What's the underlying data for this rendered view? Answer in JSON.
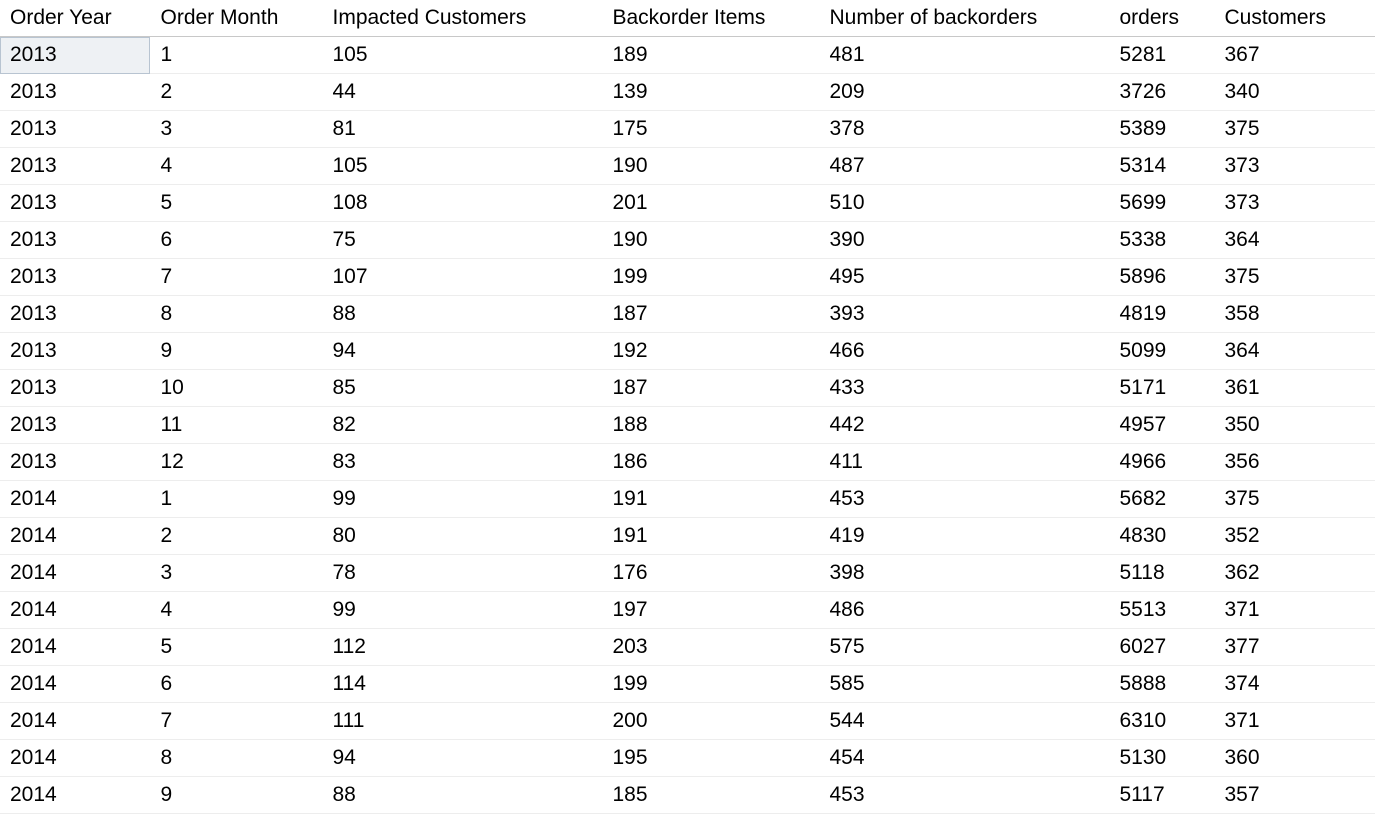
{
  "table": {
    "headers": [
      "Order Year",
      "Order Month",
      "Impacted Customers",
      "Backorder Items",
      "Number of backorders",
      "orders",
      "Customers"
    ],
    "rows": [
      {
        "year": "2013",
        "month": "1",
        "impacted": "105",
        "backitems": "189",
        "backnum": "481",
        "orders": "5281",
        "customers": "367"
      },
      {
        "year": "2013",
        "month": "2",
        "impacted": "44",
        "backitems": "139",
        "backnum": "209",
        "orders": "3726",
        "customers": "340"
      },
      {
        "year": "2013",
        "month": "3",
        "impacted": "81",
        "backitems": "175",
        "backnum": "378",
        "orders": "5389",
        "customers": "375"
      },
      {
        "year": "2013",
        "month": "4",
        "impacted": "105",
        "backitems": "190",
        "backnum": "487",
        "orders": "5314",
        "customers": "373"
      },
      {
        "year": "2013",
        "month": "5",
        "impacted": "108",
        "backitems": "201",
        "backnum": "510",
        "orders": "5699",
        "customers": "373"
      },
      {
        "year": "2013",
        "month": "6",
        "impacted": "75",
        "backitems": "190",
        "backnum": "390",
        "orders": "5338",
        "customers": "364"
      },
      {
        "year": "2013",
        "month": "7",
        "impacted": "107",
        "backitems": "199",
        "backnum": "495",
        "orders": "5896",
        "customers": "375"
      },
      {
        "year": "2013",
        "month": "8",
        "impacted": "88",
        "backitems": "187",
        "backnum": "393",
        "orders": "4819",
        "customers": "358"
      },
      {
        "year": "2013",
        "month": "9",
        "impacted": "94",
        "backitems": "192",
        "backnum": "466",
        "orders": "5099",
        "customers": "364"
      },
      {
        "year": "2013",
        "month": "10",
        "impacted": "85",
        "backitems": "187",
        "backnum": "433",
        "orders": "5171",
        "customers": "361"
      },
      {
        "year": "2013",
        "month": "11",
        "impacted": "82",
        "backitems": "188",
        "backnum": "442",
        "orders": "4957",
        "customers": "350"
      },
      {
        "year": "2013",
        "month": "12",
        "impacted": "83",
        "backitems": "186",
        "backnum": "411",
        "orders": "4966",
        "customers": "356"
      },
      {
        "year": "2014",
        "month": "1",
        "impacted": "99",
        "backitems": "191",
        "backnum": "453",
        "orders": "5682",
        "customers": "375"
      },
      {
        "year": "2014",
        "month": "2",
        "impacted": "80",
        "backitems": "191",
        "backnum": "419",
        "orders": "4830",
        "customers": "352"
      },
      {
        "year": "2014",
        "month": "3",
        "impacted": "78",
        "backitems": "176",
        "backnum": "398",
        "orders": "5118",
        "customers": "362"
      },
      {
        "year": "2014",
        "month": "4",
        "impacted": "99",
        "backitems": "197",
        "backnum": "486",
        "orders": "5513",
        "customers": "371"
      },
      {
        "year": "2014",
        "month": "5",
        "impacted": "112",
        "backitems": "203",
        "backnum": "575",
        "orders": "6027",
        "customers": "377"
      },
      {
        "year": "2014",
        "month": "6",
        "impacted": "114",
        "backitems": "199",
        "backnum": "585",
        "orders": "5888",
        "customers": "374"
      },
      {
        "year": "2014",
        "month": "7",
        "impacted": "111",
        "backitems": "200",
        "backnum": "544",
        "orders": "6310",
        "customers": "371"
      },
      {
        "year": "2014",
        "month": "8",
        "impacted": "94",
        "backitems": "195",
        "backnum": "454",
        "orders": "5130",
        "customers": "360"
      },
      {
        "year": "2014",
        "month": "9",
        "impacted": "88",
        "backitems": "185",
        "backnum": "453",
        "orders": "5117",
        "customers": "357"
      }
    ],
    "selected": {
      "row": 0,
      "col": 0
    }
  }
}
